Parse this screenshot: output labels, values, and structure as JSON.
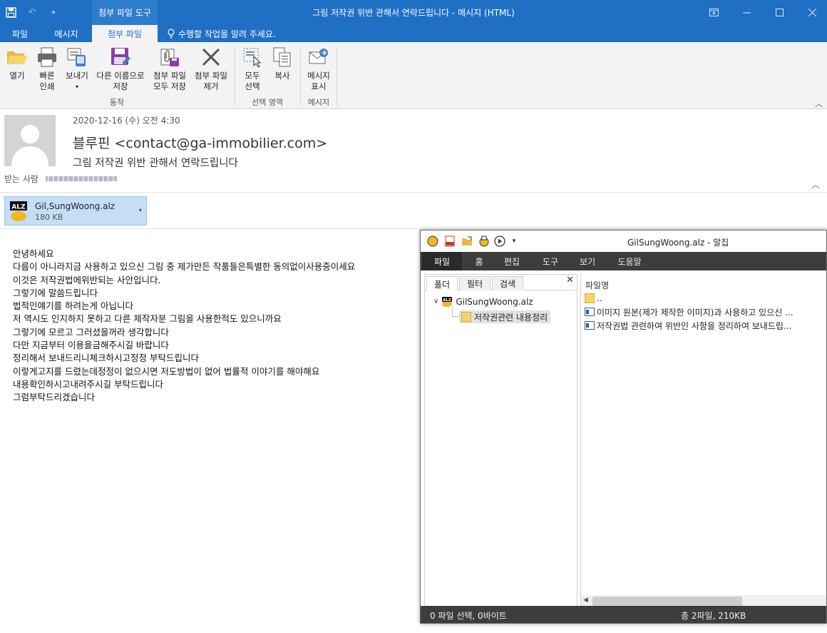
{
  "window": {
    "title": "그림 저작권 위반 관해서 연락드립니다 - 메시지 (HTML)",
    "context_tab_title": "첨부 파일 도구"
  },
  "tabs": [
    {
      "label": "파일"
    },
    {
      "label": "메시지"
    },
    {
      "label": "첨부 파일"
    }
  ],
  "tellme": "수행할 작업을 알려 주세요.",
  "ribbon": {
    "buttons": {
      "open": [
        "열기"
      ],
      "quick_print": [
        "빠른",
        "인쇄"
      ],
      "send": [
        "보내기"
      ],
      "save_as": [
        "다른 이름으로",
        "저장"
      ],
      "save_all": [
        "첨부 파일",
        "모두 저장"
      ],
      "remove": [
        "첨부 파일",
        "제거"
      ],
      "select_all": [
        "모두",
        "선택"
      ],
      "copy": [
        "복사"
      ],
      "show_message": [
        "메시지",
        "표시"
      ]
    },
    "groups": {
      "actions": "동작",
      "selection": "선택 영역",
      "message": "메시지"
    }
  },
  "message": {
    "date": "2020-12-16 (수) 오전 4:30",
    "from": "블루핀 <contact@ga-immobilier.com>",
    "subject": "그림 저작권 위반 관해서 연락드립니다",
    "to_label": "받는 사람"
  },
  "attachment": {
    "badge": "ALZ",
    "name": "Gil,SungWoong.alz",
    "size": "180 KB"
  },
  "body_lines": [
    "안녕하세요",
    "다름이 아니라지금 사용하고 있으신 그림 중 제가만든 작품들은특별한 동의없이사용중이세요",
    "이것은 저작권법에위반되는 사안입니다.",
    "그렇기에 말씀드립니다",
    "법적인얘기를 하려는게 아닙니다",
    "저 역시도 인지하지 못하고 다른 제작자분 그림을 사용한적도 있으니까요",
    "그렇기에 모르고 그러셨을꺼라 생각합니다",
    "다만 지금부터 이용을금해주시길 바랍니다",
    "정리해서 보내드리니체크하시고정정 부탁드립니다",
    "이렇게고지를 드렸는데정정이 없으시면 저도방법이 없어 법률적 이야기를 해야해요",
    "내용확인하시고내려주시길 부탁드립니다",
    "그럼부탁드리겠습니다"
  ],
  "alzip": {
    "title": "GilSungWoong.alz - 알집",
    "menus": [
      "파일",
      "홈",
      "편집",
      "도구",
      "보기",
      "도움말"
    ],
    "left_tabs": [
      "폴더",
      "필터",
      "검색"
    ],
    "tree_root": "GilSungWoong.alz",
    "tree_child": "저작권관련 내용정리",
    "col_header": "파일명",
    "files": [
      "..",
      "이미지 원본(제가 제작한 이미지)과 사용하고 있으신 ...",
      "저작권법 관련하여 위반인 사항을 정리하여 보내드립..."
    ],
    "status_left": "0 파일 선택,  0바이트",
    "status_right": "총 2파일,  210KB"
  },
  "colors": {
    "accent": "#1f6fc5",
    "alzip_bar": "#3d3d3d",
    "attachment_bg": "#c5def5"
  }
}
